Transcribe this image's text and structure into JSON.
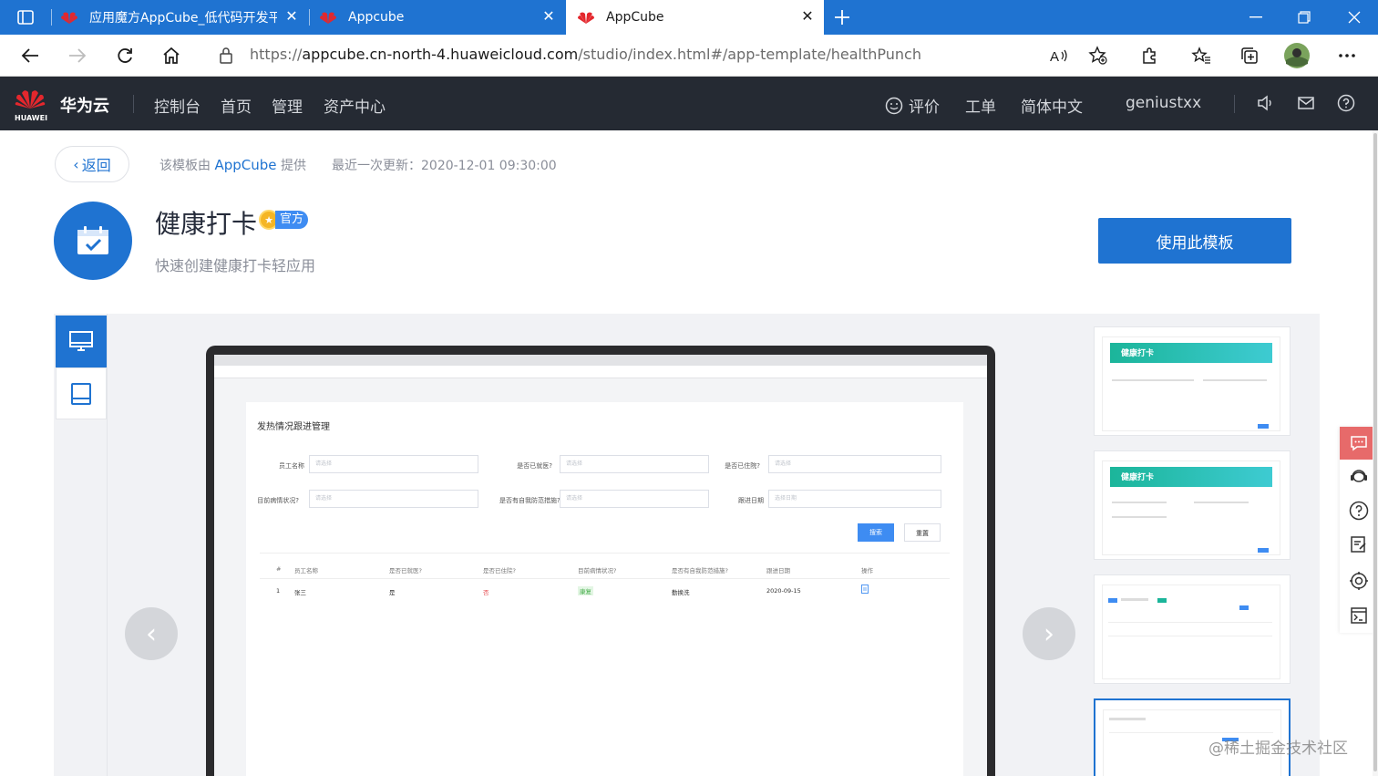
{
  "browser": {
    "tabs": [
      {
        "title": "应用魔方AppCube_低代码开发平",
        "active": false
      },
      {
        "title": "Appcube",
        "active": false
      },
      {
        "title": "AppCube",
        "active": true
      }
    ],
    "url_scheme": "https://",
    "url_host": "appcube.cn-north-4.huaweicloud.com",
    "url_path": "/studio/index.html#/app-template/healthPunch"
  },
  "header": {
    "logo_text": "HUAWEI",
    "brand": "华为云",
    "nav": [
      "控制台",
      "首页",
      "管理",
      "资产中心"
    ],
    "right": {
      "feedback": "评价",
      "ticket": "工单",
      "language": "简体中文",
      "user": "geniustxx"
    }
  },
  "template": {
    "back_label": "返回",
    "provided_prefix": "该模板由",
    "provider": "AppCube",
    "provided_suffix": "提供",
    "updated": "最近一次更新：2020-12-01 09:30:00",
    "title": "健康打卡",
    "official_badge": "官方",
    "description": "快速创建健康打卡轻应用",
    "use_button": "使用此模板"
  },
  "preview": {
    "screen_title": "发热情况跟进管理",
    "fields": [
      {
        "label": "员工名称",
        "placeholder": "请选择"
      },
      {
        "label": "是否已就医?",
        "placeholder": "请选择"
      },
      {
        "label": "是否已住院?",
        "placeholder": "请选择"
      },
      {
        "label": "目前病情状况?",
        "placeholder": "请选择"
      },
      {
        "label": "是否有自我防范措施?",
        "placeholder": "请选择"
      },
      {
        "label": "跟进日期",
        "placeholder": "选择日期"
      }
    ],
    "search_button": "搜索",
    "reset_button": "重置",
    "table_headers": [
      "#",
      "员工名称",
      "是否已就医?",
      "是否已住院?",
      "目前病情状况?",
      "是否有自我防范措施?",
      "跟进日期",
      "操作"
    ],
    "table_rows": [
      [
        "1",
        "张三",
        "是",
        "否",
        "康复",
        "勤换洗",
        "2020-09-15",
        ""
      ]
    ],
    "thumb_banner": "健康打卡"
  },
  "colors": {
    "accent": "#1f73d1",
    "header_bg": "#252a33",
    "tab_strip": "#1f73d1",
    "feedback_float": "#e76a6a"
  },
  "watermark": "@稀土掘金技术社区"
}
